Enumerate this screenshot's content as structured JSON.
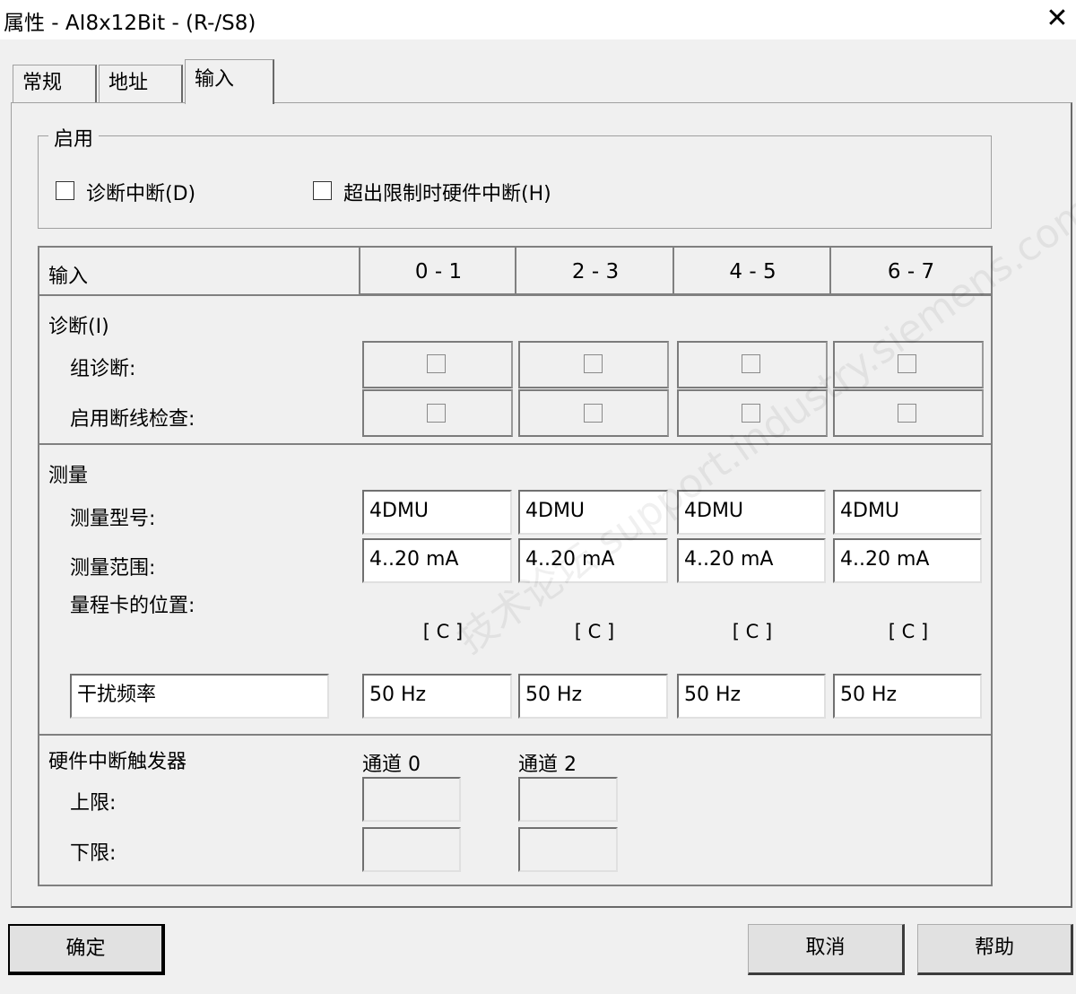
{
  "window": {
    "title": "属性 - AI8x12Bit - (R-/S8)",
    "close_glyph": "✕"
  },
  "tabs": [
    {
      "label": "常规",
      "active": false
    },
    {
      "label": "地址",
      "active": false
    },
    {
      "label": "输入",
      "active": true
    }
  ],
  "enable_group": {
    "title": "启用",
    "options": [
      {
        "label": "诊断中断(D)",
        "checked": false
      },
      {
        "label": "超出限制时硬件中断(H)",
        "checked": false
      }
    ]
  },
  "table": {
    "header_label": "输入",
    "columns": [
      "0 - 1",
      "2 - 3",
      "4 - 5",
      "6 - 7"
    ],
    "diagnostics": {
      "title": "诊断(I)",
      "group_diag_label": "组诊断:",
      "wire_break_label": "启用断线检查:",
      "group_diag": [
        false,
        false,
        false,
        false
      ],
      "wire_break": [
        false,
        false,
        false,
        false
      ]
    },
    "measurement": {
      "title": "测量",
      "type_label": "测量型号:",
      "range_label": "测量范围:",
      "card_pos_label": "量程卡的位置:",
      "types": [
        "4DMU",
        "4DMU",
        "4DMU",
        "4DMU"
      ],
      "ranges": [
        "4..20 mA",
        "4..20 mA",
        "4..20 mA",
        "4..20 mA"
      ],
      "card_positions": [
        "[ C ]",
        "[ C ]",
        "[ C ]",
        "[ C ]"
      ],
      "interference_label": "干扰频率",
      "interference": [
        "50 Hz",
        "50 Hz",
        "50 Hz",
        "50 Hz"
      ]
    },
    "hw_interrupt": {
      "title": "硬件中断触发器",
      "upper_label": "上限:",
      "lower_label": "下限:",
      "channels": [
        "通道 0",
        "通道 2"
      ]
    }
  },
  "buttons": {
    "ok": "确定",
    "cancel": "取消",
    "help": "帮助"
  },
  "watermark": "技术论坛 support.industry.siemens.com/cs"
}
